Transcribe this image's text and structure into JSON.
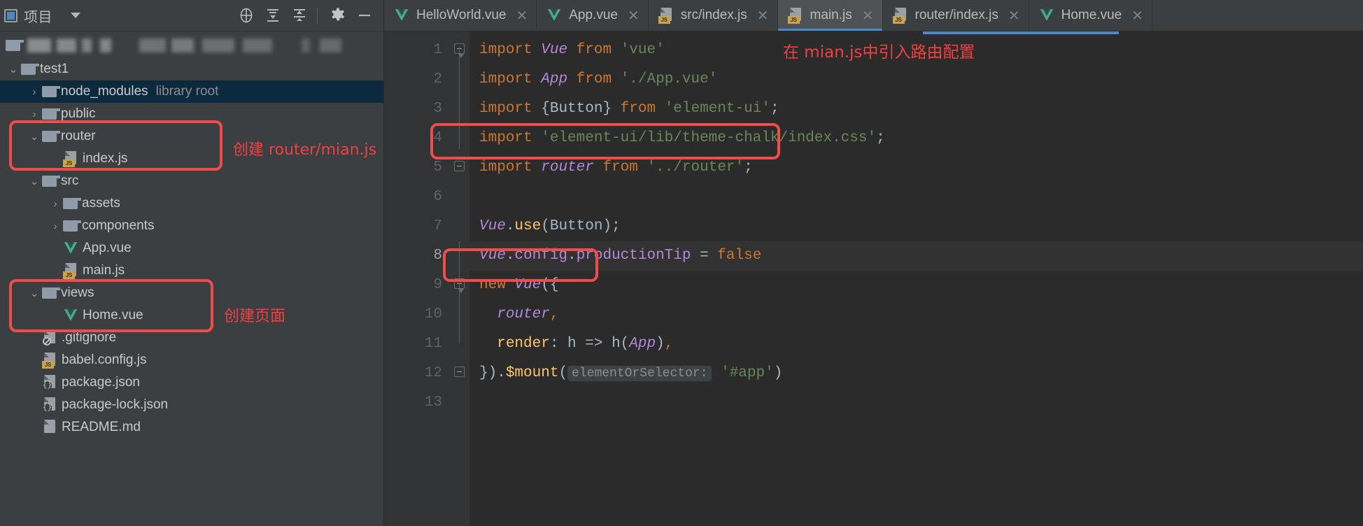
{
  "panel": {
    "title": "项目",
    "icons": [
      "project-icon",
      "chevron-down-icon",
      "locate-icon",
      "expand-all-icon",
      "collapse-all-icon",
      "settings-gear-icon",
      "minimize-icon"
    ]
  },
  "tree": {
    "redacted_path_label": "",
    "items": [
      {
        "name": "test1",
        "type": "folder",
        "indent": 0,
        "arrow": "down",
        "selected": false,
        "sublabel": ""
      },
      {
        "name": "node_modules",
        "type": "folder",
        "indent": 1,
        "arrow": "right",
        "selected": true,
        "sublabel": "library root"
      },
      {
        "name": "public",
        "type": "folder",
        "indent": 1,
        "arrow": "right",
        "selected": false,
        "sublabel": ""
      },
      {
        "name": "router",
        "type": "folder",
        "indent": 1,
        "arrow": "down",
        "selected": false,
        "sublabel": ""
      },
      {
        "name": "index.js",
        "type": "js",
        "indent": 2,
        "arrow": "none",
        "selected": false,
        "sublabel": ""
      },
      {
        "name": "src",
        "type": "folder",
        "indent": 1,
        "arrow": "down",
        "selected": false,
        "sublabel": ""
      },
      {
        "name": "assets",
        "type": "folder",
        "indent": 2,
        "arrow": "right",
        "selected": false,
        "sublabel": ""
      },
      {
        "name": "components",
        "type": "folder",
        "indent": 2,
        "arrow": "right",
        "selected": false,
        "sublabel": ""
      },
      {
        "name": "App.vue",
        "type": "vue",
        "indent": 2,
        "arrow": "none",
        "selected": false,
        "sublabel": ""
      },
      {
        "name": "main.js",
        "type": "js",
        "indent": 2,
        "arrow": "none",
        "selected": false,
        "sublabel": ""
      },
      {
        "name": "views",
        "type": "folder",
        "indent": 1,
        "arrow": "down",
        "selected": false,
        "sublabel": ""
      },
      {
        "name": "Home.vue",
        "type": "vue",
        "indent": 2,
        "arrow": "none",
        "selected": false,
        "sublabel": ""
      },
      {
        "name": ".gitignore",
        "type": "git",
        "indent": 1,
        "arrow": "none",
        "selected": false,
        "sublabel": ""
      },
      {
        "name": "babel.config.js",
        "type": "js",
        "indent": 1,
        "arrow": "none",
        "selected": false,
        "sublabel": ""
      },
      {
        "name": "package.json",
        "type": "json",
        "indent": 1,
        "arrow": "none",
        "selected": false,
        "sublabel": ""
      },
      {
        "name": "package-lock.json",
        "type": "json",
        "indent": 1,
        "arrow": "none",
        "selected": false,
        "sublabel": ""
      },
      {
        "name": "README.md",
        "type": "md",
        "indent": 1,
        "arrow": "none",
        "selected": false,
        "sublabel": ""
      }
    ]
  },
  "annotations": {
    "tree": [
      {
        "text": "创建 router/mian.js"
      },
      {
        "text": "创建页面"
      }
    ],
    "editor_note": "在 mian.js中引入路由配置"
  },
  "tabs": [
    {
      "label": "HelloWorld.vue",
      "icon": "vue-file-icon",
      "active": false,
      "close": "✕"
    },
    {
      "label": "App.vue",
      "icon": "vue-file-icon",
      "active": false,
      "close": "✕"
    },
    {
      "label": "src/index.js",
      "icon": "js-file-icon",
      "active": false,
      "close": "✕"
    },
    {
      "label": "main.js",
      "icon": "js-file-icon",
      "active": true,
      "close": "✕"
    },
    {
      "label": "router/index.js",
      "icon": "js-file-icon",
      "active": false,
      "close": "✕"
    },
    {
      "label": "Home.vue",
      "icon": "vue-file-icon",
      "active": false,
      "close": "✕"
    }
  ],
  "editor": {
    "current_line": 8,
    "line_numbers": [
      "1",
      "2",
      "3",
      "4",
      "5",
      "6",
      "7",
      "8",
      "9",
      "10",
      "11",
      "12",
      "13"
    ],
    "lines": [
      {
        "n": 1,
        "tokens": [
          {
            "t": "import",
            "c": "kw"
          },
          {
            "t": " ",
            "c": "plain"
          },
          {
            "t": "Vue",
            "c": "cls"
          },
          {
            "t": " ",
            "c": "plain"
          },
          {
            "t": "from",
            "c": "kw"
          },
          {
            "t": " ",
            "c": "plain"
          },
          {
            "t": "'vue'",
            "c": "str"
          }
        ]
      },
      {
        "n": 2,
        "tokens": [
          {
            "t": "import",
            "c": "kw"
          },
          {
            "t": " ",
            "c": "plain"
          },
          {
            "t": "App",
            "c": "cls"
          },
          {
            "t": " ",
            "c": "plain"
          },
          {
            "t": "from",
            "c": "kw"
          },
          {
            "t": " ",
            "c": "plain"
          },
          {
            "t": "'./App.vue'",
            "c": "str"
          }
        ]
      },
      {
        "n": 3,
        "tokens": [
          {
            "t": "import",
            "c": "kw"
          },
          {
            "t": " ",
            "c": "plain"
          },
          {
            "t": "{Button}",
            "c": "plain"
          },
          {
            "t": " ",
            "c": "plain"
          },
          {
            "t": "from",
            "c": "kw"
          },
          {
            "t": " ",
            "c": "plain"
          },
          {
            "t": "'element-ui'",
            "c": "str"
          },
          {
            "t": ";",
            "c": "plain"
          }
        ]
      },
      {
        "n": 4,
        "tokens": [
          {
            "t": "import",
            "c": "kw"
          },
          {
            "t": " ",
            "c": "plain"
          },
          {
            "t": "'element-ui/lib/theme-chalk/index.css'",
            "c": "str"
          },
          {
            "t": ";",
            "c": "plain"
          }
        ]
      },
      {
        "n": 5,
        "tokens": [
          {
            "t": "import",
            "c": "kw"
          },
          {
            "t": " ",
            "c": "plain"
          },
          {
            "t": "router",
            "c": "cls"
          },
          {
            "t": " ",
            "c": "plain"
          },
          {
            "t": "from",
            "c": "kw"
          },
          {
            "t": " ",
            "c": "plain"
          },
          {
            "t": "'../router'",
            "c": "str"
          },
          {
            "t": ";",
            "c": "plain"
          }
        ]
      },
      {
        "n": 6,
        "tokens": []
      },
      {
        "n": 7,
        "tokens": [
          {
            "t": "Vue",
            "c": "cls"
          },
          {
            "t": ".",
            "c": "plain"
          },
          {
            "t": "use",
            "c": "fn"
          },
          {
            "t": "(",
            "c": "plain"
          },
          {
            "t": "Button",
            "c": "plain"
          },
          {
            "t": ");",
            "c": "plain"
          }
        ]
      },
      {
        "n": 8,
        "tokens": [
          {
            "t": "Vue",
            "c": "cls"
          },
          {
            "t": ".",
            "c": "plain"
          },
          {
            "t": "config",
            "c": "prop"
          },
          {
            "t": ".",
            "c": "plain"
          },
          {
            "t": "productionTip",
            "c": "prop"
          },
          {
            "t": " = ",
            "c": "plain"
          },
          {
            "t": "false",
            "c": "kw"
          }
        ]
      },
      {
        "n": 9,
        "tokens": [
          {
            "t": "new",
            "c": "kw"
          },
          {
            "t": " ",
            "c": "plain"
          },
          {
            "t": "Vue",
            "c": "cls"
          },
          {
            "t": "({",
            "c": "plain"
          }
        ]
      },
      {
        "n": 10,
        "tokens": [
          {
            "t": "  ",
            "c": "plain"
          },
          {
            "t": "router",
            "c": "cls"
          },
          {
            "t": ",",
            "c": "kw"
          }
        ]
      },
      {
        "n": 11,
        "tokens": [
          {
            "t": "  ",
            "c": "plain"
          },
          {
            "t": "render",
            "c": "fn"
          },
          {
            "t": ": h => ",
            "c": "plain"
          },
          {
            "t": "h",
            "c": "plain"
          },
          {
            "t": "(",
            "c": "plain"
          },
          {
            "t": "App",
            "c": "cls"
          },
          {
            "t": ")",
            "c": "plain"
          },
          {
            "t": ",",
            "c": "kw"
          }
        ]
      },
      {
        "n": 12,
        "tokens": [
          {
            "t": "}).",
            "c": "plain"
          },
          {
            "t": "$mount",
            "c": "fn"
          },
          {
            "t": "(",
            "c": "plain"
          },
          {
            "t": "elementOrSelector:",
            "c": "hint"
          },
          {
            "t": "'#app'",
            "c": "str"
          },
          {
            "t": ")",
            "c": "plain"
          }
        ]
      },
      {
        "n": 13,
        "tokens": []
      }
    ]
  },
  "colors": {
    "panel_bg": "#3c3f41",
    "editor_bg": "#2b2b2b",
    "gutter_bg": "#313335",
    "selection_bg": "#0d293e",
    "current_line_bg": "#323232",
    "active_tab_bg": "#4e5254",
    "accent_blue": "#4a88c7",
    "annotation_red": "#ef4c4c",
    "keyword": "#cc7832",
    "string": "#6a8759",
    "class": "#b389d8",
    "function": "#ffc66d",
    "plain": "#a9b7c6"
  }
}
